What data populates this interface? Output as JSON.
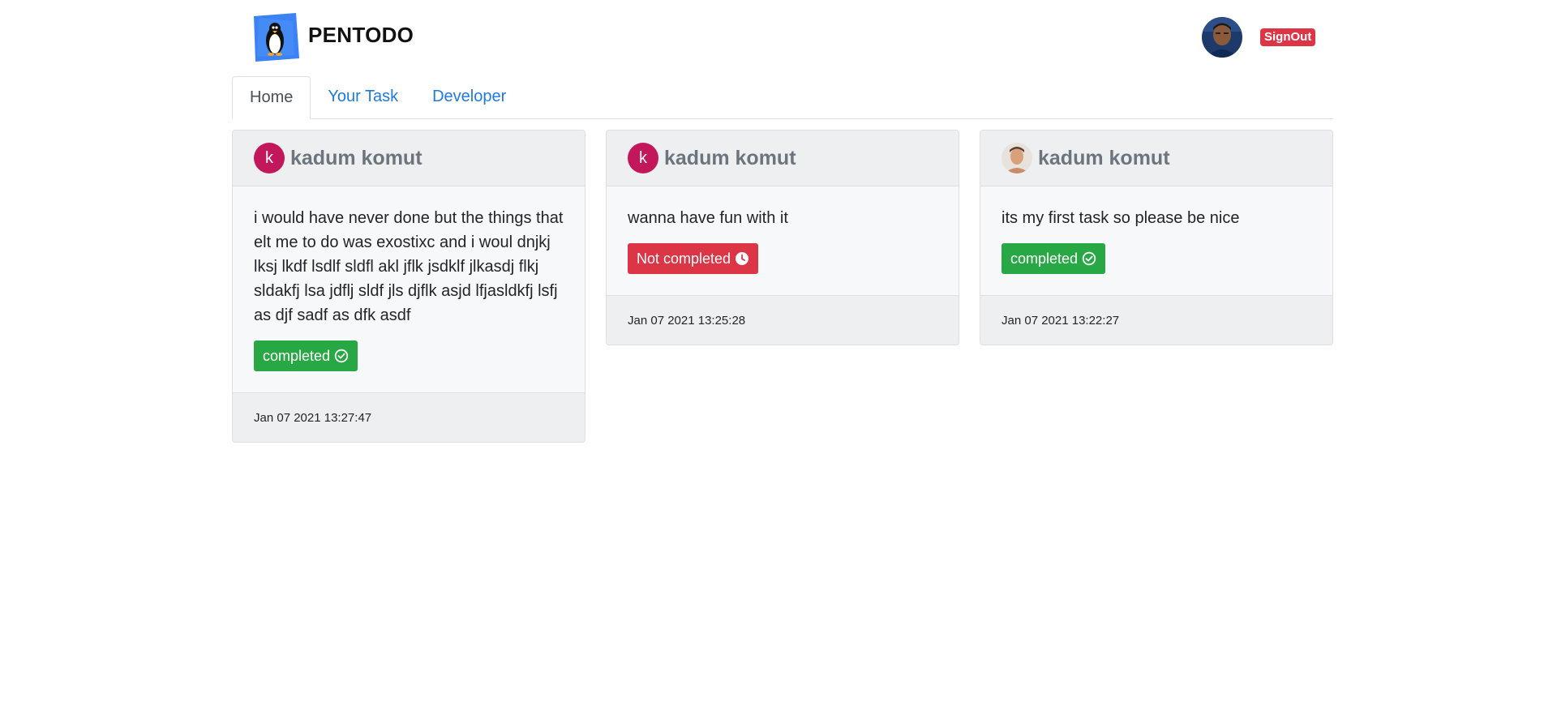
{
  "app": {
    "brand": "PENTODO",
    "signout_label": "SignOut"
  },
  "tabs": [
    {
      "label": "Home",
      "active": true
    },
    {
      "label": "Your Task",
      "active": false
    },
    {
      "label": "Developer",
      "active": false
    }
  ],
  "cards": [
    {
      "avatar_letter": "k",
      "author": "kadum komut",
      "text": "i would have never done but the things that elt me to do was exostixc and i woul dnjkj lksj lkdf lsdlf sldfl akl jflk jsdklf jlkasdj flkj sldakfj lsa jdflj sldf jls djflk asjd lfjasldkfj lsfj as djf sadf as dfk asdf",
      "status": "completed",
      "status_icon": "check-circle-icon",
      "timestamp": "Jan 07 2021 13:27:47"
    },
    {
      "avatar_letter": "k",
      "author": "kadum komut",
      "text": "wanna have fun with it",
      "status": "Not completed",
      "status_icon": "clock-icon",
      "timestamp": "Jan 07 2021 13:25:28"
    },
    {
      "avatar_letter": "",
      "author": "kadum komut",
      "text": "its my first task so please be nice",
      "status": "completed",
      "status_icon": "check-circle-icon",
      "timestamp": "Jan 07 2021 13:22:27"
    }
  ],
  "colors": {
    "completed": "#28a745",
    "not_completed": "#dc3545",
    "link": "#1f7ae0",
    "avatar": "#c2185b"
  }
}
